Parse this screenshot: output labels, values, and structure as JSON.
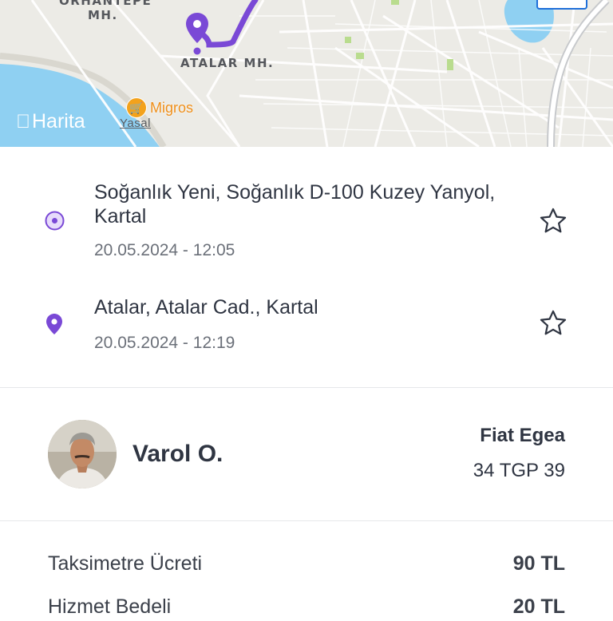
{
  "map": {
    "area_labels": {
      "orhantepe": "ORHANTEPE",
      "orhantepe_mh": "MH.",
      "atalar": "ATALAR MH."
    },
    "poi": {
      "label": "Migros",
      "icon": "shopping-basket-icon"
    },
    "attribution": "Harita",
    "legal": "Yasal",
    "route_color": "#7a49d6"
  },
  "trip": {
    "pickup": {
      "address": "Soğanlık Yeni, Soğanlık D-100 Kuzey Yanyol, Kartal",
      "time": "20.05.2024 - 12:05"
    },
    "dropoff": {
      "address": "Atalar, Atalar Cad., Kartal",
      "time": "20.05.2024 - 12:19"
    }
  },
  "driver": {
    "name": "Varol O.",
    "car_model": "Fiat Egea",
    "plate": "34 TGP 39"
  },
  "fare": {
    "rows": [
      {
        "label": "Taksimetre Ücreti",
        "value": "90 TL"
      },
      {
        "label": "Hizmet Bedeli",
        "value": "20 TL"
      }
    ]
  },
  "colors": {
    "accent": "#7a49d6",
    "text": "#2f3542",
    "muted": "#6b7079"
  }
}
